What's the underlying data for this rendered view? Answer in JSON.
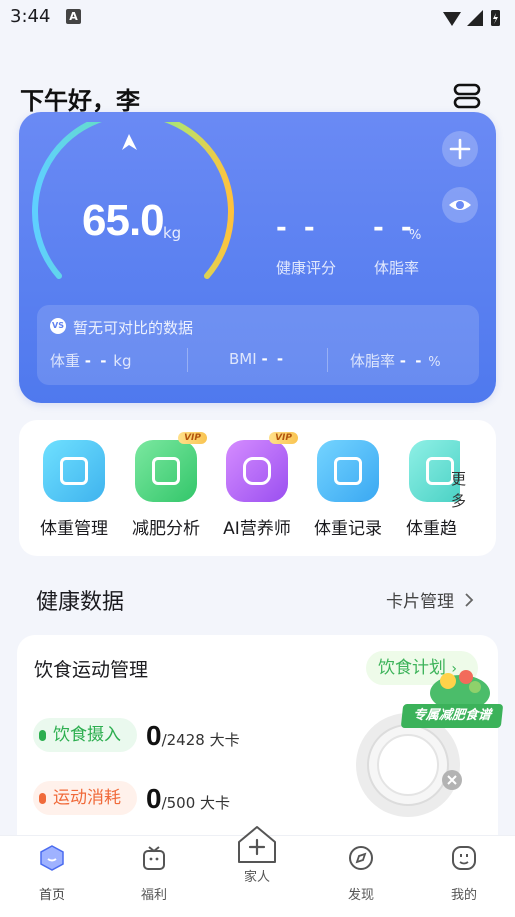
{
  "status_bar": {
    "time": "3:44",
    "notification_glyph": "A"
  },
  "header": {
    "greeting": "下午好，李"
  },
  "weight_card": {
    "weight_value": "65.0",
    "weight_unit": "kg",
    "gauge_fill_fraction": 0.75,
    "health_score_value": "- -",
    "health_score_label": "健康评分",
    "body_fat_value": "- -",
    "body_fat_unit": "%",
    "body_fat_label": "体脂率",
    "compare": {
      "badge": "VS",
      "title": "暂无可对比的数据",
      "items": [
        {
          "label": "体重",
          "value": "- -",
          "unit": "kg"
        },
        {
          "label": "BMI",
          "value": "- -",
          "unit": ""
        },
        {
          "label": "体脂率",
          "value": "- -",
          "unit": "%"
        }
      ]
    }
  },
  "features": {
    "items": [
      {
        "label": "体重管理",
        "color": "#4fc6f0",
        "vip": ""
      },
      {
        "label": "减肥分析",
        "color": "#4cd67a",
        "vip": "VIP"
      },
      {
        "label": "AI营养师",
        "color": "#b66bf0",
        "vip": "VIP"
      },
      {
        "label": "体重记录",
        "color": "#4ab8f5",
        "vip": ""
      },
      {
        "label": "体重趋",
        "color": "#5fd8d0",
        "vip": ""
      }
    ],
    "more_label": "更多"
  },
  "health_section": {
    "title": "健康数据",
    "card_manage_label": "卡片管理"
  },
  "diet_card": {
    "title": "饮食运动管理",
    "plan_button": "饮食计划",
    "intake_label": "饮食摄入",
    "intake_value": "0",
    "intake_target": "/2428 大卡",
    "exercise_label": "运动消耗",
    "exercise_value": "0",
    "exercise_target": "/500 大卡",
    "banner_text": "专属减肥食谱"
  },
  "bottom_nav": {
    "items": [
      {
        "label": "首页"
      },
      {
        "label": "福利"
      },
      {
        "label": "家人"
      },
      {
        "label": "发现"
      },
      {
        "label": "我的"
      }
    ]
  },
  "colors": {
    "accent_blue": "#5a80f0",
    "green": "#2cae4f",
    "orange": "#f06a3a"
  }
}
